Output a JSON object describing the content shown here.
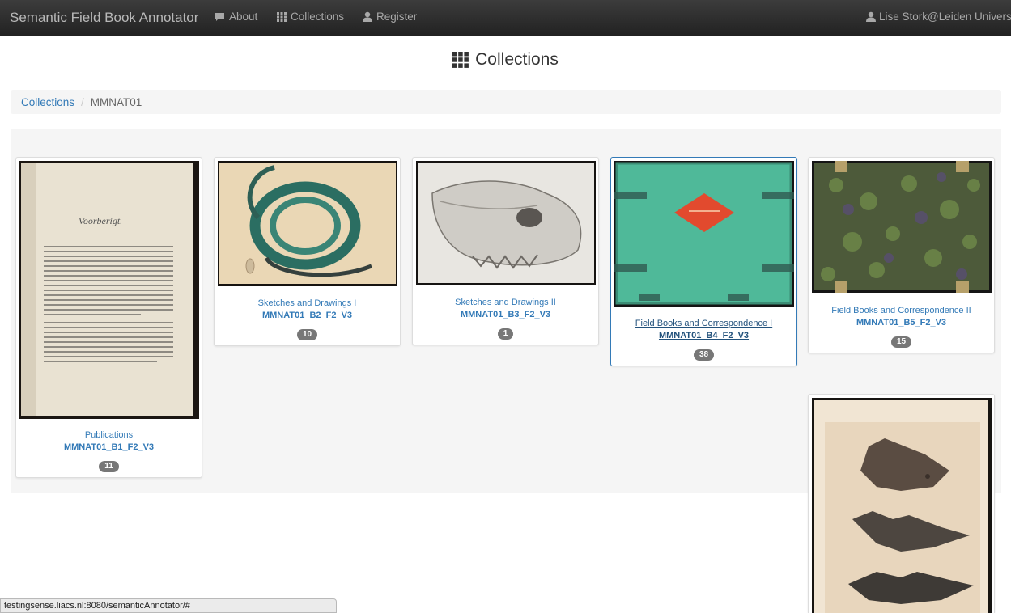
{
  "navbar": {
    "brand": "Semantic Field Book Annotator",
    "links": [
      {
        "label": "About",
        "icon": "comment-icon"
      },
      {
        "label": "Collections",
        "icon": "grid-icon"
      },
      {
        "label": "Register",
        "icon": "user-icon"
      }
    ],
    "user": {
      "label": "Lise Stork@Leiden University",
      "icon": "user-icon"
    }
  },
  "page": {
    "title": "Collections",
    "title_icon": "grid-icon"
  },
  "breadcrumb": {
    "root": "Collections",
    "current": "MMNAT01"
  },
  "collections": [
    {
      "title": "Publications",
      "id": "MMNAT01_B1_F2_V3",
      "count": "11"
    },
    {
      "title": "Sketches and Drawings I",
      "id": "MMNAT01_B2_F2_V3",
      "count": "10"
    },
    {
      "title": "Sketches and Drawings II",
      "id": "MMNAT01_B3_F2_V3",
      "count": "1"
    },
    {
      "title": "Field Books and Correspondence I",
      "id": "MMNAT01_B4_F2_V3",
      "count": "38"
    },
    {
      "title": "Field Books and Correspondence II",
      "id": "MMNAT01_B5_F2_V3",
      "count": "15"
    }
  ],
  "status_bar": {
    "url": "testingsense.liacs.nl:8080/semanticAnnotator/#"
  },
  "colors": {
    "navbar": "#222222",
    "link": "#337ab7",
    "badge": "#777777",
    "teal_cover": "#4bb89a"
  }
}
